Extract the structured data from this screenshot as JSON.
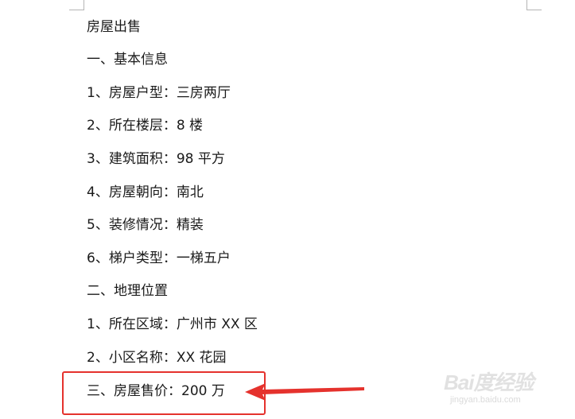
{
  "document": {
    "lines": [
      "房屋出售",
      "一、基本信息",
      "1、房屋户型：三房两厅",
      "2、所在楼层：8 楼",
      "3、建筑面积：98 平方",
      "4、房屋朝向：南北",
      "5、装修情况：精装",
      "6、梯户类型：一梯五户",
      "二、地理位置",
      "1、所在区域：广州市 XX 区",
      "2、小区名称：XX 花园",
      "三、房屋售价：200 万"
    ]
  },
  "annotation": {
    "color": "#e5322d"
  },
  "watermark": {
    "brand": "Bai度经验",
    "url": "jingyan.baidu.com"
  }
}
